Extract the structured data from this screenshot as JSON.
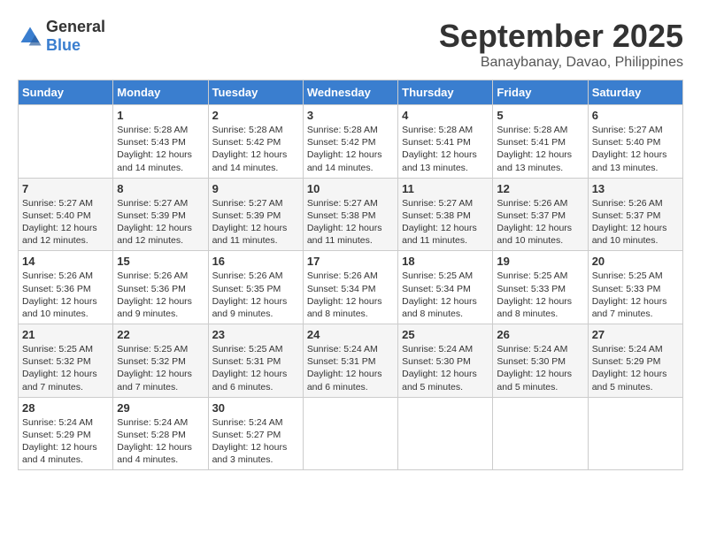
{
  "header": {
    "logo_general": "General",
    "logo_blue": "Blue",
    "month_title": "September 2025",
    "subtitle": "Banaybanay, Davao, Philippines"
  },
  "days_of_week": [
    "Sunday",
    "Monday",
    "Tuesday",
    "Wednesday",
    "Thursday",
    "Friday",
    "Saturday"
  ],
  "weeks": [
    [
      {
        "day": "",
        "text": ""
      },
      {
        "day": "1",
        "text": "Sunrise: 5:28 AM\nSunset: 5:43 PM\nDaylight: 12 hours\nand 14 minutes."
      },
      {
        "day": "2",
        "text": "Sunrise: 5:28 AM\nSunset: 5:42 PM\nDaylight: 12 hours\nand 14 minutes."
      },
      {
        "day": "3",
        "text": "Sunrise: 5:28 AM\nSunset: 5:42 PM\nDaylight: 12 hours\nand 14 minutes."
      },
      {
        "day": "4",
        "text": "Sunrise: 5:28 AM\nSunset: 5:41 PM\nDaylight: 12 hours\nand 13 minutes."
      },
      {
        "day": "5",
        "text": "Sunrise: 5:28 AM\nSunset: 5:41 PM\nDaylight: 12 hours\nand 13 minutes."
      },
      {
        "day": "6",
        "text": "Sunrise: 5:27 AM\nSunset: 5:40 PM\nDaylight: 12 hours\nand 13 minutes."
      }
    ],
    [
      {
        "day": "7",
        "text": "Sunrise: 5:27 AM\nSunset: 5:40 PM\nDaylight: 12 hours\nand 12 minutes."
      },
      {
        "day": "8",
        "text": "Sunrise: 5:27 AM\nSunset: 5:39 PM\nDaylight: 12 hours\nand 12 minutes."
      },
      {
        "day": "9",
        "text": "Sunrise: 5:27 AM\nSunset: 5:39 PM\nDaylight: 12 hours\nand 11 minutes."
      },
      {
        "day": "10",
        "text": "Sunrise: 5:27 AM\nSunset: 5:38 PM\nDaylight: 12 hours\nand 11 minutes."
      },
      {
        "day": "11",
        "text": "Sunrise: 5:27 AM\nSunset: 5:38 PM\nDaylight: 12 hours\nand 11 minutes."
      },
      {
        "day": "12",
        "text": "Sunrise: 5:26 AM\nSunset: 5:37 PM\nDaylight: 12 hours\nand 10 minutes."
      },
      {
        "day": "13",
        "text": "Sunrise: 5:26 AM\nSunset: 5:37 PM\nDaylight: 12 hours\nand 10 minutes."
      }
    ],
    [
      {
        "day": "14",
        "text": "Sunrise: 5:26 AM\nSunset: 5:36 PM\nDaylight: 12 hours\nand 10 minutes."
      },
      {
        "day": "15",
        "text": "Sunrise: 5:26 AM\nSunset: 5:36 PM\nDaylight: 12 hours\nand 9 minutes."
      },
      {
        "day": "16",
        "text": "Sunrise: 5:26 AM\nSunset: 5:35 PM\nDaylight: 12 hours\nand 9 minutes."
      },
      {
        "day": "17",
        "text": "Sunrise: 5:26 AM\nSunset: 5:34 PM\nDaylight: 12 hours\nand 8 minutes."
      },
      {
        "day": "18",
        "text": "Sunrise: 5:25 AM\nSunset: 5:34 PM\nDaylight: 12 hours\nand 8 minutes."
      },
      {
        "day": "19",
        "text": "Sunrise: 5:25 AM\nSunset: 5:33 PM\nDaylight: 12 hours\nand 8 minutes."
      },
      {
        "day": "20",
        "text": "Sunrise: 5:25 AM\nSunset: 5:33 PM\nDaylight: 12 hours\nand 7 minutes."
      }
    ],
    [
      {
        "day": "21",
        "text": "Sunrise: 5:25 AM\nSunset: 5:32 PM\nDaylight: 12 hours\nand 7 minutes."
      },
      {
        "day": "22",
        "text": "Sunrise: 5:25 AM\nSunset: 5:32 PM\nDaylight: 12 hours\nand 7 minutes."
      },
      {
        "day": "23",
        "text": "Sunrise: 5:25 AM\nSunset: 5:31 PM\nDaylight: 12 hours\nand 6 minutes."
      },
      {
        "day": "24",
        "text": "Sunrise: 5:24 AM\nSunset: 5:31 PM\nDaylight: 12 hours\nand 6 minutes."
      },
      {
        "day": "25",
        "text": "Sunrise: 5:24 AM\nSunset: 5:30 PM\nDaylight: 12 hours\nand 5 minutes."
      },
      {
        "day": "26",
        "text": "Sunrise: 5:24 AM\nSunset: 5:30 PM\nDaylight: 12 hours\nand 5 minutes."
      },
      {
        "day": "27",
        "text": "Sunrise: 5:24 AM\nSunset: 5:29 PM\nDaylight: 12 hours\nand 5 minutes."
      }
    ],
    [
      {
        "day": "28",
        "text": "Sunrise: 5:24 AM\nSunset: 5:29 PM\nDaylight: 12 hours\nand 4 minutes."
      },
      {
        "day": "29",
        "text": "Sunrise: 5:24 AM\nSunset: 5:28 PM\nDaylight: 12 hours\nand 4 minutes."
      },
      {
        "day": "30",
        "text": "Sunrise: 5:24 AM\nSunset: 5:27 PM\nDaylight: 12 hours\nand 3 minutes."
      },
      {
        "day": "",
        "text": ""
      },
      {
        "day": "",
        "text": ""
      },
      {
        "day": "",
        "text": ""
      },
      {
        "day": "",
        "text": ""
      }
    ]
  ]
}
